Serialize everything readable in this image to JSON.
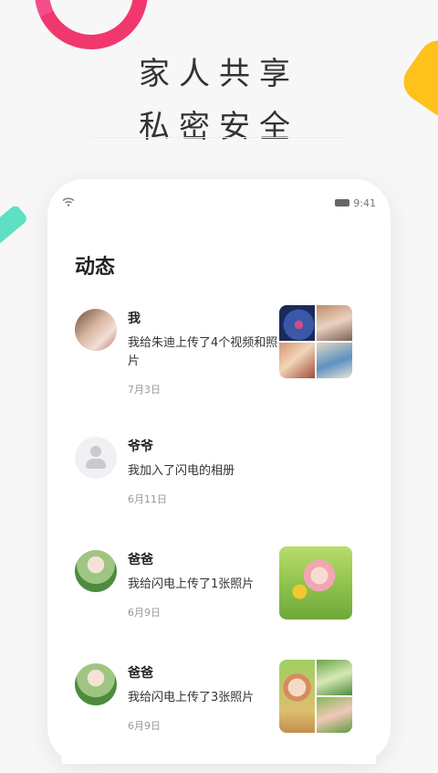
{
  "headline": {
    "line1": "家人共享",
    "line2": "私密安全"
  },
  "status_bar": {
    "time": "9:41"
  },
  "page": {
    "title": "动态"
  },
  "feed": [
    {
      "name": "我",
      "message": "我给朱迪上传了4个视频和照片",
      "date": "7月3日",
      "avatar": "photo",
      "thumb": "grid-4"
    },
    {
      "name": "爷爷",
      "message": "我加入了闪电的相册",
      "date": "6月11日",
      "avatar": "placeholder-user-icon",
      "thumb": null
    },
    {
      "name": "爸爸",
      "message": "我给闪电上传了1张照片",
      "date": "6月9日",
      "avatar": "photo",
      "thumb": "single"
    },
    {
      "name": "爸爸",
      "message": "我给闪电上传了3张照片",
      "date": "6月9日",
      "avatar": "photo",
      "thumb": "grid-3"
    }
  ],
  "colors": {
    "accent_pink": "#f0386e",
    "accent_mint": "#5fe0c2",
    "accent_yellow": "#ffc21c"
  }
}
